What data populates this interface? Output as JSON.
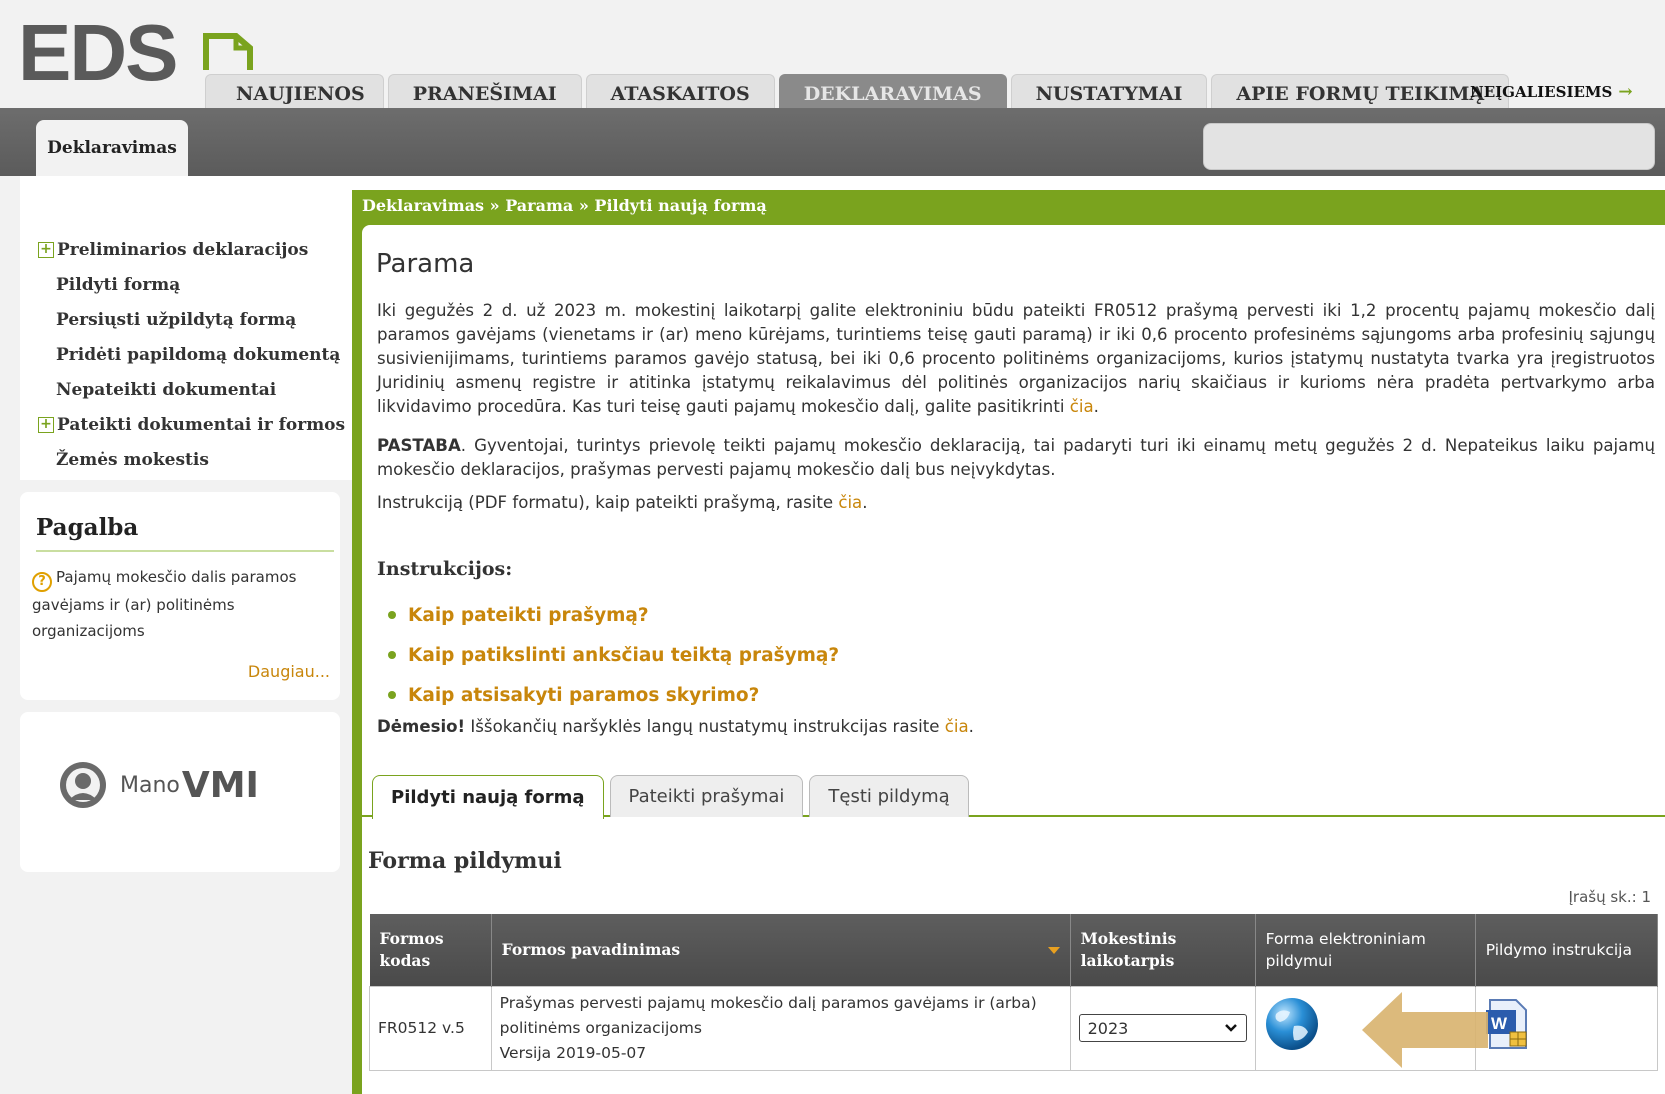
{
  "header": {
    "logo_text": "EDS",
    "tabs": [
      "NAUJIENOS",
      "PRANEŠIMAI",
      "ATASKAITOS",
      "DEKLARAVIMAS",
      "NUSTATYMAI",
      "APIE FORMŲ TEIKIMĄ"
    ],
    "active_tab": "DEKLARAVIMAS",
    "accessibility_link": "NEĮGALIESIEMS",
    "subtab": "Deklaravimas"
  },
  "sidebar": {
    "items": [
      {
        "label": "Preliminarios deklaracijos",
        "expandable": true
      },
      {
        "label": "Pildyti formą",
        "expandable": false
      },
      {
        "label": "Persiųsti užpildytą formą",
        "expandable": false
      },
      {
        "label": "Pridėti papildomą dokumentą",
        "expandable": false
      },
      {
        "label": "Nepateikti dokumentai",
        "expandable": false
      },
      {
        "label": "Pateikti dokumentai ir formos",
        "expandable": true
      },
      {
        "label": "Žemės mokestis",
        "expandable": false
      }
    ],
    "help": {
      "title": "Pagalba",
      "topic": "Pajamų mokesčio dalis paramos gavėjams ir (ar) politinėms organizacijoms",
      "more": "Daugiau..."
    },
    "vmi": {
      "mano": "Mano",
      "vmi": "VMI"
    }
  },
  "main": {
    "breadcrumb": "Deklaravimas » Parama » Pildyti naują formą",
    "title": "Parama",
    "intro": "Iki gegužės 2 d. už 2023 m. mokestinį laikotarpį galite elektroniniu būdu pateikti FR0512 prašymą pervesti iki 1,2 procentų pajamų mokesčio dalį paramos gavėjams (vienetams ir (ar) meno kūrėjams, turintiems teisę gauti paramą) ir iki 0,6 procento profesinėms sąjungoms arba profesinių sąjungų susivienijimams, turintiems paramos gavėjo statusą, bei iki 0,6 procento politinėms organizacijoms, kurios įstatymų nustatyta tvarka yra įregistruotos Juridinių asmenų registre ir atitinka įstatymų reikalavimus dėl politinės organizacijos narių skaičiaus ir kurioms nėra pradėta pertvarkymo arba likvidavimo procedūra. Kas turi teisę gauti pajamų mokesčio dalį, galite pasitikrinti",
    "link_cia": "čia",
    "note_label": "PASTABA",
    "note_text": ". Gyventojai, turintys prievolę teikti pajamų mokesčio deklaraciją, tai padaryti turi iki einamų metų gegužės 2 d. Nepateikus laiku pajamų mokesčio deklaracijos, prašymas pervesti pajamų mokesčio dalį bus neįvykdytas.",
    "instr_pdf_text": "Instrukciją (PDF formatu), kaip pateikti prašymą, rasite",
    "instructions_title": "Instrukcijos:",
    "instructions": [
      "Kaip pateikti prašymą?",
      "Kaip patikslinti anksčiau teiktą prašymą?",
      "Kaip atsisakyti paramos skyrimo?"
    ],
    "attention_label": "Dėmesio!",
    "attention_text": "Iššokančių naršyklės langų nustatymų instrukcijas rasite",
    "form_tabs": [
      "Pildyti naują formą",
      "Pateikti prašymai",
      "Tęsti pildymą"
    ],
    "active_form_tab": "Pildyti naują formą",
    "form_section_title": "Forma pildymui",
    "records_count": "Įrašų sk.: 1",
    "table": {
      "headers": [
        "Formos kodas",
        "Formos pavadinimas",
        "Mokestinis laikotarpis",
        "Forma elektroniniam pildymui",
        "Pildymo instrukcija"
      ],
      "rows": [
        {
          "code": "FR0512 v.5",
          "name_line1": "Prašymas pervesti pajamų mokesčio dalį paramos gavėjams ir (arba)",
          "name_line2": "politinėms organizacijoms",
          "name_line3": "Versija 2019-05-07",
          "period": "2023",
          "fill_icon": "globe-icon",
          "instr_icon": "word-doc-icon"
        }
      ]
    },
    "highlight_color": "#d8b26e",
    "accent_color": "#7aa31e",
    "link_color": "#c8860b"
  }
}
